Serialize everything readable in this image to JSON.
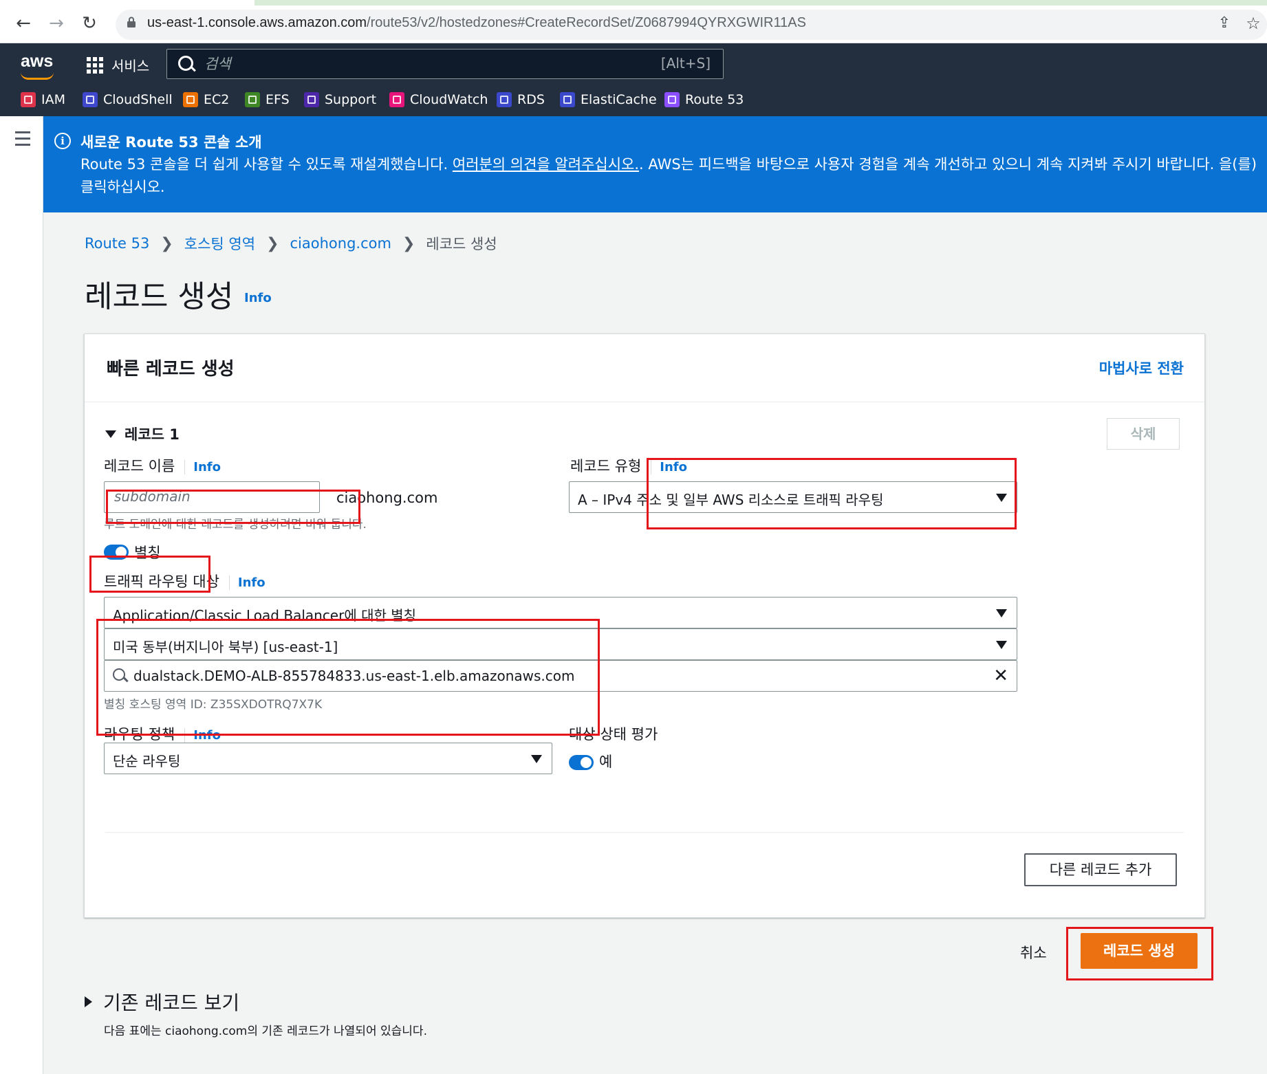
{
  "browser": {
    "url_host": "us-east-1.console.aws.amazon.com",
    "url_path": "/route53/v2/hostedzones#CreateRecordSet/Z0687994QYRXGWIR11AS"
  },
  "aws_nav": {
    "logo": "aws",
    "services_label": "서비스",
    "search_placeholder": "검색",
    "search_hint": "[Alt+S]",
    "favorites": [
      {
        "label": "IAM",
        "color": "#dd344c"
      },
      {
        "label": "CloudShell",
        "color": "#3f48cc"
      },
      {
        "label": "EC2",
        "color": "#ed7100"
      },
      {
        "label": "EFS",
        "color": "#3f8624"
      },
      {
        "label": "Support",
        "color": "#4d27aa"
      },
      {
        "label": "CloudWatch",
        "color": "#e7157b"
      },
      {
        "label": "RDS",
        "color": "#3b48cc"
      },
      {
        "label": "ElastiCache",
        "color": "#3b48cc"
      },
      {
        "label": "Route 53",
        "color": "#8c4fff"
      }
    ]
  },
  "banner": {
    "title": "새로운 Route 53 콘솔 소개",
    "text_before": "Route 53 콘솔을 더 쉽게 사용할 수 있도록 재설계했습니다. ",
    "link": "여러분의 의견을 알려주십시오.",
    "text_after": ". AWS는 피드백을 바탕으로 사용자 경험을 계속 개선하고 있으니 계속 지켜봐 주시기 바랍니다. 을(를) 클릭하십시오."
  },
  "breadcrumb": [
    "Route 53",
    "호스팅 영역",
    "ciaohong.com",
    "레코드 생성"
  ],
  "page": {
    "title": "레코드 생성",
    "info": "Info"
  },
  "panel": {
    "title": "빠른 레코드 생성",
    "wizard_link": "마법사로 전환",
    "record_heading": "레코드 1",
    "delete_button": "삭제",
    "record_name_label": "레코드 이름",
    "record_name_placeholder": "subdomain",
    "domain_suffix": "ciaohong.com",
    "record_name_hint": "루트 도메인에 대한 레코드를 생성하려면 비워 둡니다.",
    "record_type_label": "레코드 유형",
    "record_type_value": "A – IPv4 주소 및 일부 AWS 리소스로 트래픽 라우팅",
    "alias_label": "별칭",
    "traffic_target_label": "트래픽 라우팅 대상",
    "target_endpoint": "Application/Classic Load Balancer에 대한 별칭",
    "target_region": "미국 동부(버지니아 북부) [us-east-1]",
    "target_lb": "dualstack.DEMO-ALB-855784833.us-east-1.elb.amazonaws.com",
    "alias_zone_hint": "별칭 호스팅 영역 ID: Z35SXDOTRQ7X7K",
    "routing_policy_label": "라우팅 정책",
    "routing_policy_value": "단순 라우팅",
    "health_label": "대상 상태 평가",
    "health_value": "예",
    "add_record_button": "다른 레코드 추가",
    "info": "Info"
  },
  "actions": {
    "cancel": "취소",
    "create": "레코드 생성"
  },
  "existing": {
    "heading": "기존 레코드 보기",
    "description": "다음 표에는 ciaohong.com의 기존 레코드가 나열되어 있습니다."
  }
}
